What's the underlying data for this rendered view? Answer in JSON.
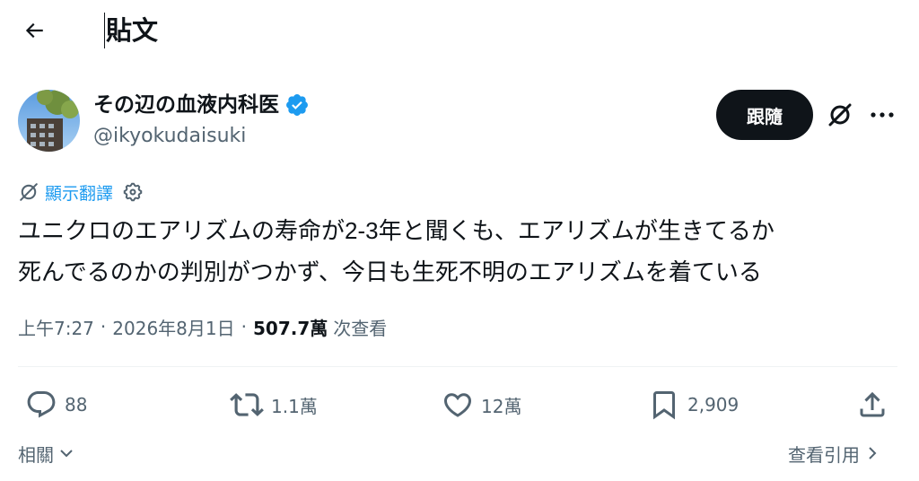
{
  "header": {
    "title": "貼文",
    "back_icon": "arrow-left-icon"
  },
  "author": {
    "name": "その辺の血液内科医",
    "handle": "@ikyokudaisuki",
    "verified": true,
    "verified_color": "#1d9bf0"
  },
  "actions_top": {
    "follow_label": "跟隨",
    "grok_icon": "grok-icon",
    "more_icon": "more-icon"
  },
  "translate": {
    "label": "顯示翻譯"
  },
  "tweet": {
    "lines": [
      {
        "before": "ユニクロのエアリズムの寿命が",
        "number": "2-3",
        "after": "年と聞くも、エアリズムが生きてるか"
      },
      {
        "text": "死んでるのかの判別がつかず、今日も生死不明のエアリズムを着ている"
      }
    ]
  },
  "meta": {
    "time": "上午7:27",
    "date": "2026年8月1日",
    "views_count": "507.7萬",
    "views_label": "次查看",
    "separator": "·"
  },
  "stats": {
    "replies": "88",
    "reposts": "1.1萬",
    "likes": "12萬",
    "bookmarks": "2,909"
  },
  "footer": {
    "related_label": "相關",
    "quotes_label": "查看引用"
  },
  "colors": {
    "accent": "#1d9bf0",
    "text": "#0f1419",
    "secondary": "#536471",
    "follow_bg": "#0f1419"
  }
}
